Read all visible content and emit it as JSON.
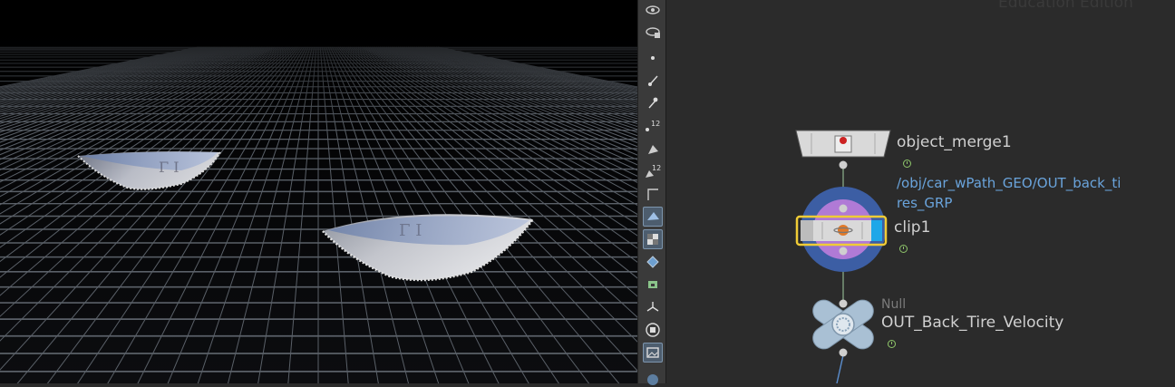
{
  "network": {
    "watermark": "Education Edition",
    "nodes": [
      {
        "name": "object_merge1",
        "path": "/obj/car_wPath_GEO/OUT_back_ti res_GRP"
      },
      {
        "name": "clip1"
      },
      {
        "name": "OUT_Back_Tire_Velocity",
        "type": "Null"
      }
    ]
  },
  "colors": {
    "viewport_bg": "#000000",
    "grid": "#5a6068",
    "node_body": "#d9d9d9",
    "selection_outline": "#f0cc36",
    "display_flag": "#1ea7e8",
    "clip_ring_outer": "#3c5ea4",
    "clip_ring_inner": "#b07ad6",
    "null_node": "#a9c0d4",
    "path_text": "#6aa4dc",
    "wire": "#7f9f7f"
  },
  "toolbar": {
    "tools": [
      "view-icon",
      "display-options-icon",
      "point-icon",
      "normal-icon",
      "vertex-icon",
      "point-numbers-icon",
      "primitive-icon",
      "primitive-numbers-icon",
      "guide-icon",
      "shaded-icon",
      "texture-icon",
      "wire-icon",
      "uv-icon",
      "transform-icon",
      "stop-icon",
      "snapshot-icon",
      "next-icon"
    ]
  }
}
